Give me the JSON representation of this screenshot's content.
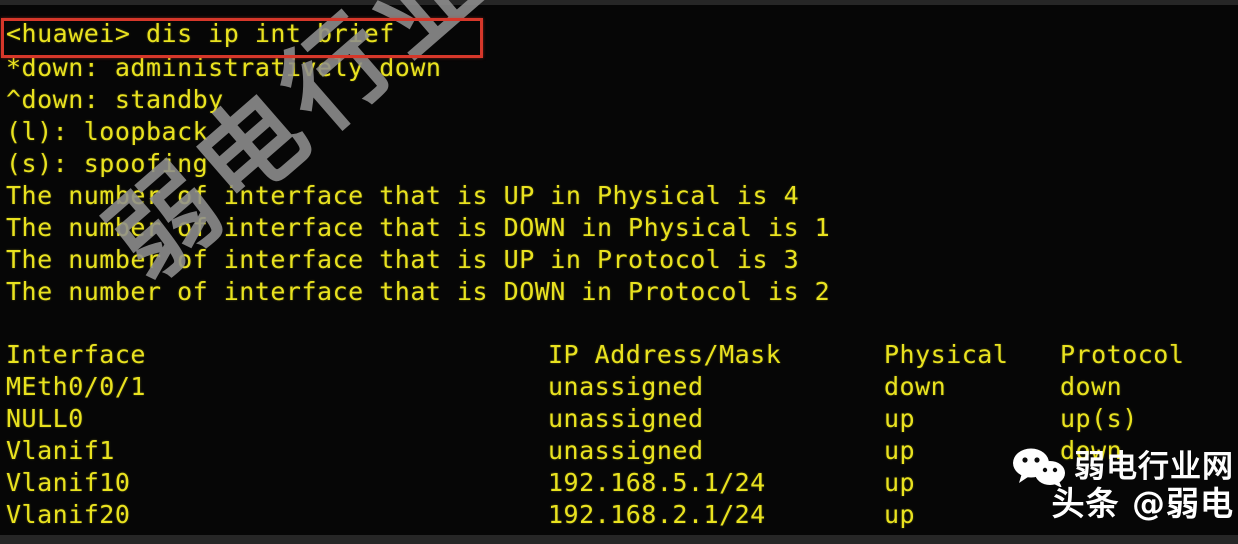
{
  "terminal": {
    "prompt_line": "<huawei> dis ip int brief",
    "legend": [
      "*down: administratively down",
      "^down: standby",
      "(l): loopback",
      "(s): spoofing"
    ],
    "summary": [
      "The number of interface that is UP in Physical is 4",
      "The number of interface that is DOWN in Physical is 1",
      "The number of interface that is UP in Protocol is 3",
      "The number of interface that is DOWN in Protocol is 2"
    ],
    "table": {
      "headers": {
        "interface": "Interface",
        "ip": "IP Address/Mask",
        "physical": "Physical",
        "protocol": "Protocol"
      },
      "rows": [
        {
          "interface": "MEth0/0/1",
          "ip": "unassigned",
          "physical": "down",
          "protocol": "down"
        },
        {
          "interface": "NULL0",
          "ip": "unassigned",
          "physical": "up",
          "protocol": "up(s)"
        },
        {
          "interface": "Vlanif1",
          "ip": "unassigned",
          "physical": "up",
          "protocol": "down"
        },
        {
          "interface": "Vlanif10",
          "ip": "192.168.5.1/24",
          "physical": "up",
          "protocol": ""
        },
        {
          "interface": "Vlanif20",
          "ip": "192.168.2.1/24",
          "physical": "up",
          "protocol": ""
        }
      ]
    }
  },
  "annotation": {
    "highlight_color": "#d6372a"
  },
  "watermark": {
    "diagonal_text": "弱电行业网",
    "corner_site": "弱电行业网",
    "corner_handle": "头条 @弱电",
    "logo": "wechat-icon",
    "color": "#8f8f8f"
  },
  "theme": {
    "background": "#060606",
    "text_color": "#e9e21f"
  }
}
